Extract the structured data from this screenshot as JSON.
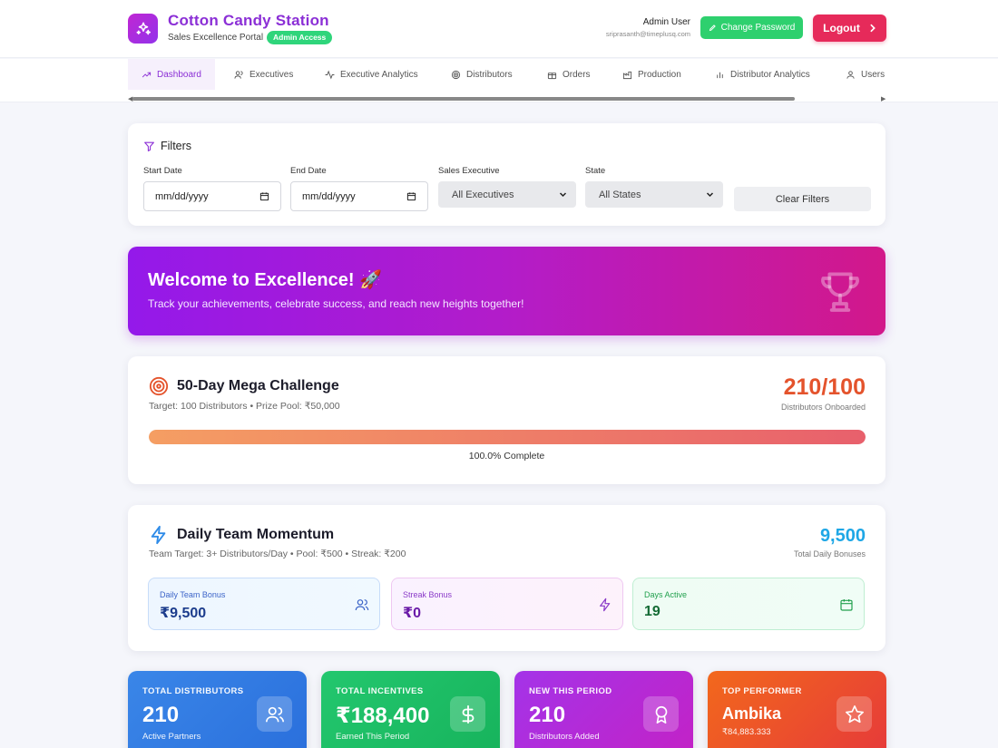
{
  "header": {
    "title": "Cotton Candy Station",
    "subtitle": "Sales Excellence Portal",
    "badge": "Admin Access",
    "user_name": "Admin User",
    "user_email": "sriprasanth@timeplusq.com",
    "change_password": "Change Password",
    "logout": "Logout"
  },
  "nav": {
    "items": [
      {
        "label": "Dashboard",
        "icon": "trend-icon"
      },
      {
        "label": "Executives",
        "icon": "users-icon"
      },
      {
        "label": "Executive Analytics",
        "icon": "activity-icon"
      },
      {
        "label": "Distributors",
        "icon": "target-icon"
      },
      {
        "label": "Orders",
        "icon": "gift-icon"
      },
      {
        "label": "Production",
        "icon": "factory-icon"
      },
      {
        "label": "Distributor Analytics",
        "icon": "bar-chart-icon"
      },
      {
        "label": "Users",
        "icon": "user-icon"
      }
    ],
    "active": "Dashboard"
  },
  "filters": {
    "title": "Filters",
    "start_date_label": "Start Date",
    "start_date_value": "mm/dd/yyyy",
    "end_date_label": "End Date",
    "end_date_value": "mm/dd/yyyy",
    "executive_label": "Sales Executive",
    "executive_value": "All Executives",
    "state_label": "State",
    "state_value": "All States",
    "clear": "Clear Filters"
  },
  "welcome": {
    "title": "Welcome to Excellence! 🚀",
    "subtitle": "Track your achievements, celebrate success, and reach new heights together!"
  },
  "challenge": {
    "title": "50-Day Mega Challenge",
    "subtitle": "Target: 100 Distributors • Prize Pool: ₹50,000",
    "count": "210/100",
    "count_label": "Distributors Onboarded",
    "progress": 1.0,
    "progress_label": "100.0% Complete"
  },
  "momentum": {
    "title": "Daily Team Momentum",
    "subtitle": "Team Target: 3+ Distributors/Day • Pool: ₹500 • Streak: ₹200",
    "total": "9,500",
    "total_label": "Total Daily Bonuses",
    "boxes": [
      {
        "label": "Daily Team Bonus",
        "value": "₹9,500",
        "icon": "users-icon"
      },
      {
        "label": "Streak Bonus",
        "value": "₹0",
        "icon": "lightning-icon"
      },
      {
        "label": "Days Active",
        "value": "19",
        "icon": "calendar-icon"
      }
    ]
  },
  "stats": [
    {
      "label": "TOTAL DISTRIBUTORS",
      "value": "210",
      "sub": "Active Partners",
      "icon": "users-icon",
      "color": "#3a86e8"
    },
    {
      "label": "TOTAL INCENTIVES",
      "value": "₹188,400",
      "sub": "Earned This Period",
      "icon": "dollar-icon",
      "color": "#23c76e"
    },
    {
      "label": "NEW THIS PERIOD",
      "value": "210",
      "sub": "Distributors Added",
      "icon": "award-icon",
      "color": "#a433e8"
    },
    {
      "label": "TOP PERFORMER",
      "value": "Ambika",
      "sub": "₹84,883.333",
      "icon": "star-icon",
      "color": "#f2681c"
    }
  ]
}
